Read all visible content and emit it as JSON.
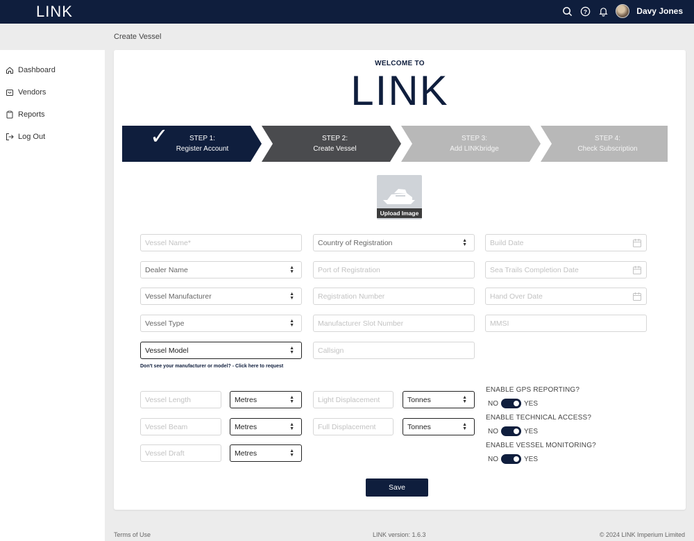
{
  "app": {
    "brand": "LINK"
  },
  "user": {
    "name": "Davy Jones"
  },
  "breadcrumb": "Create Vessel",
  "sidebar": {
    "items": [
      {
        "label": "Dashboard",
        "icon": "home-icon"
      },
      {
        "label": "Vendors",
        "icon": "shopping-bag-icon"
      },
      {
        "label": "Reports",
        "icon": "clipboard-icon"
      },
      {
        "label": "Log Out",
        "icon": "logout-icon"
      }
    ]
  },
  "header": {
    "welcome": "WELCOME TO",
    "logo": "LINK"
  },
  "steps": [
    {
      "title": "STEP 1:",
      "label": "Register Account",
      "state": "complete"
    },
    {
      "title": "STEP 2:",
      "label": "Create Vessel",
      "state": "current"
    },
    {
      "title": "STEP 3:",
      "label": "Add LINKbridge",
      "state": "upcoming"
    },
    {
      "title": "STEP 4:",
      "label": "Check Subscription",
      "state": "upcoming"
    }
  ],
  "upload": {
    "label": "Upload Image"
  },
  "form": {
    "vessel_name": "Vessel Name*",
    "dealer_name": "Dealer Name",
    "vessel_manufacturer": "Vessel Manufacturer",
    "vessel_type": "Vessel Type",
    "vessel_model": "Vessel Model",
    "country_of_registration": "Country of Registration",
    "port_of_registration": "Port of Registration",
    "registration_number": "Registration Number",
    "manufacturer_slot_number": "Manufacturer Slot Number",
    "callsign": "Callsign",
    "build_date": "Build Date",
    "sea_trails_completion_date": "Sea Trails Completion Date",
    "hand_over_date": "Hand Over Date",
    "mmsi": "MMSI",
    "request_link": "Don't see your manufacturer or model? - Click here to request",
    "vessel_length": "Vessel Length",
    "vessel_beam": "Vessel Beam",
    "vessel_draft": "Vessel Draft",
    "length_unit": "Metres",
    "beam_unit": "Metres",
    "draft_unit": "Metres",
    "light_displacement": "Light Displacement",
    "full_displacement": "Full Displacement",
    "light_unit": "Tonnes",
    "full_unit": "Tonnes"
  },
  "toggles": [
    {
      "label": "ENABLE GPS REPORTING?",
      "off": "NO",
      "on": "YES",
      "value": true
    },
    {
      "label": "ENABLE TECHNICAL ACCESS?",
      "off": "NO",
      "on": "YES",
      "value": true
    },
    {
      "label": "ENABLE VESSEL MONITORING?",
      "off": "NO",
      "on": "YES",
      "value": true
    }
  ],
  "actions": {
    "save": "Save"
  },
  "footer": {
    "terms": "Terms of Use",
    "version": "LINK version: 1.6.3",
    "copyright": "© 2024 LINK Imperium Limited"
  },
  "colors": {
    "navy": "#0f1e3d",
    "step_current": "#4a4b4e",
    "step_upcoming": "#b8b8b8"
  }
}
